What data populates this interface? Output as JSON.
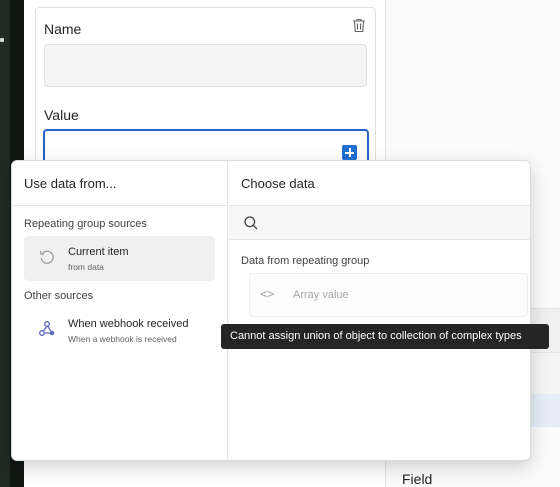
{
  "form": {
    "name_label": "Name",
    "name_value": "",
    "value_label": "Value",
    "value_value": ""
  },
  "picker": {
    "left_title": "Use data from...",
    "repeating_section": "Repeating group sources",
    "current_item_title": "Current item",
    "current_item_sub": "from data",
    "other_section": "Other sources",
    "webhook_title": "When webhook received",
    "webhook_sub": "When a webhook is received",
    "right_title": "Choose data",
    "search_placeholder": "",
    "group_label": "Data from repeating group",
    "array_label": "Array value"
  },
  "tooltip": {
    "text": "Cannot assign union of object to collection of complex types"
  },
  "right_panel": {
    "field_label": "Field"
  },
  "colors": {
    "accent": "#1f6fd1",
    "tooltip_bg": "#252525"
  },
  "icons": {
    "delete": "trash-icon",
    "add": "plus-icon",
    "current_item": "refresh-icon",
    "webhook": "webhook-icon",
    "search": "search-icon",
    "array": "code-brackets-icon"
  }
}
